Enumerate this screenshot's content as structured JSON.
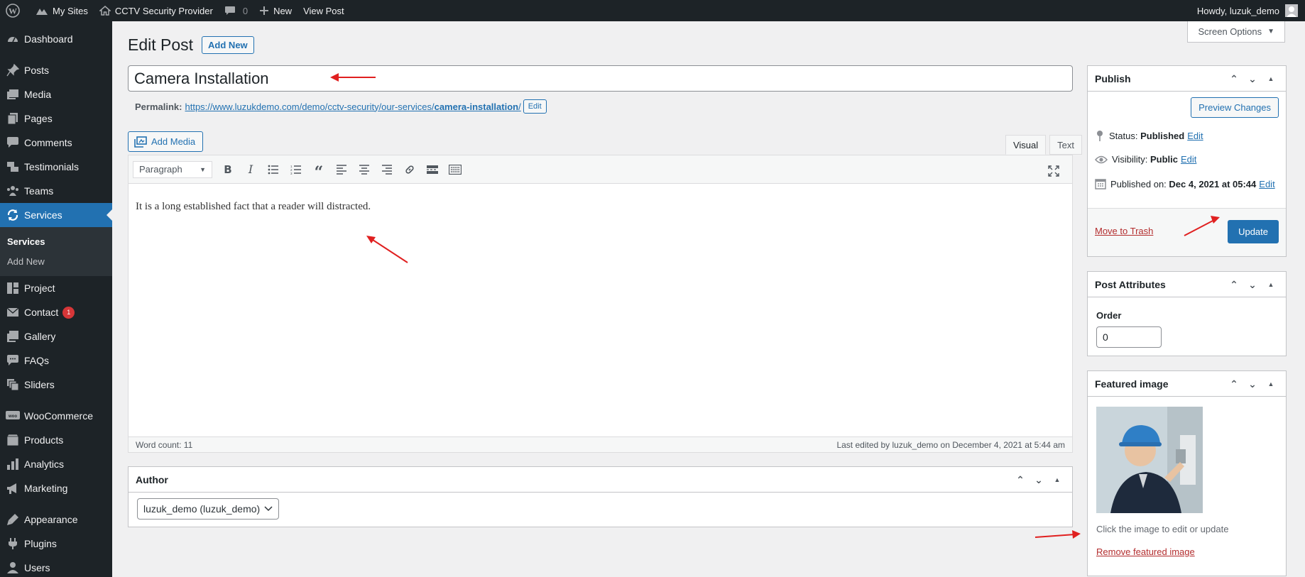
{
  "admin_bar": {
    "my_sites": "My Sites",
    "site_name": "CCTV Security Provider",
    "comments_count": "0",
    "new_label": "New",
    "view_post": "View Post",
    "howdy": "Howdy, luzuk_demo"
  },
  "sidebar": {
    "items": [
      {
        "label": "Dashboard",
        "icon": "dashboard-icon"
      },
      {
        "label": "Posts",
        "icon": "pin-icon"
      },
      {
        "label": "Media",
        "icon": "media-icon"
      },
      {
        "label": "Pages",
        "icon": "pages-icon"
      },
      {
        "label": "Comments",
        "icon": "comment-icon"
      },
      {
        "label": "Testimonials",
        "icon": "testimonials-icon"
      },
      {
        "label": "Teams",
        "icon": "groups-icon"
      },
      {
        "label": "Services",
        "icon": "services-icon"
      },
      {
        "label": "Project",
        "icon": "project-icon"
      },
      {
        "label": "Contact",
        "icon": "mail-icon",
        "badge": "1"
      },
      {
        "label": "Gallery",
        "icon": "gallery-icon"
      },
      {
        "label": "FAQs",
        "icon": "faq-icon"
      },
      {
        "label": "Sliders",
        "icon": "sliders-icon"
      },
      {
        "label": "WooCommerce",
        "icon": "woo-icon"
      },
      {
        "label": "Products",
        "icon": "products-icon"
      },
      {
        "label": "Analytics",
        "icon": "analytics-icon"
      },
      {
        "label": "Marketing",
        "icon": "megaphone-icon"
      },
      {
        "label": "Appearance",
        "icon": "appearance-icon"
      },
      {
        "label": "Plugins",
        "icon": "plugins-icon"
      },
      {
        "label": "Users",
        "icon": "users-icon"
      }
    ],
    "submenu": [
      "Services",
      "Add New"
    ]
  },
  "screen_options": "Screen Options",
  "page": {
    "title": "Edit Post",
    "add_new": "Add New"
  },
  "post": {
    "title": "Camera Installation",
    "permalink_label": "Permalink:",
    "permalink_base": "https://www.luzukdemo.com/demo/cctv-security/our-services/",
    "permalink_slug": "camera-installation",
    "permalink_trail": "/",
    "permalink_edit": "Edit",
    "content": "It is a long established fact that a reader will distracted."
  },
  "editor": {
    "add_media": "Add Media",
    "tab_visual": "Visual",
    "tab_text": "Text",
    "format": "Paragraph",
    "word_count": "Word count: 11",
    "last_edited": "Last edited by luzuk_demo on December 4, 2021 at 5:44 am"
  },
  "author_box": {
    "title": "Author",
    "selected": "luzuk_demo (luzuk_demo)"
  },
  "publish": {
    "title": "Publish",
    "preview": "Preview Changes",
    "status_label": "Status:",
    "status_value": "Published",
    "visibility_label": "Visibility:",
    "visibility_value": "Public",
    "published_label": "Published on:",
    "published_value": "Dec 4, 2021 at 05:44",
    "edit": "Edit",
    "trash": "Move to Trash",
    "update": "Update"
  },
  "attributes": {
    "title": "Post Attributes",
    "order_label": "Order",
    "order_value": "0"
  },
  "featured": {
    "title": "Featured image",
    "caption": "Click the image to edit or update",
    "remove": "Remove featured image"
  },
  "colors": {
    "admin_bar_bg": "#1d2327",
    "accent": "#2271b1",
    "danger": "#b32d2e",
    "annotation_arrow": "#e02020"
  }
}
